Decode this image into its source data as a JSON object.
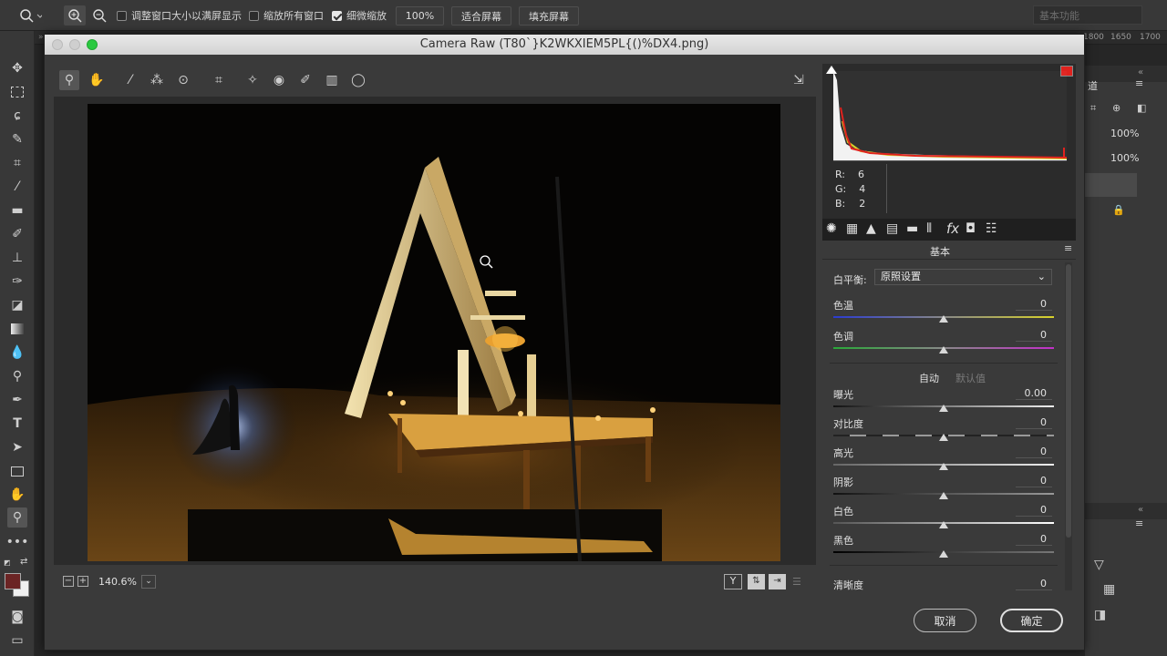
{
  "optbar": {
    "fit_window_label": "调整窗口大小以满屏显示",
    "zoom_all_label": "缩放所有窗口",
    "scrubby_label": "细微缩放",
    "zoom_value": "100%",
    "fit_screen": "适合屏幕",
    "fill_screen": "填充屏幕",
    "workspace": "基本功能"
  },
  "ruler": {
    "ticks": [
      "1800",
      "1650",
      "1700"
    ]
  },
  "rpanel": {
    "tab": "道",
    "pct1": "100%",
    "pct2": "100%"
  },
  "dialog": {
    "title": "Camera Raw (T80`}K2WKXIEM5PL{()%DX4.png)",
    "zoom": "140.6%",
    "cancel": "取消",
    "ok": "确定"
  },
  "rgb": {
    "r_label": "R:",
    "r": "6",
    "g_label": "G:",
    "g": "4",
    "b_label": "B:",
    "b": "2"
  },
  "panel": {
    "title": "基本",
    "wb_label": "白平衡:",
    "wb_value": "原照设置",
    "auto": "自动",
    "default": "默认值",
    "sliders": [
      {
        "label": "色温",
        "value": "0"
      },
      {
        "label": "色调",
        "value": "0"
      },
      {
        "label": "曝光",
        "value": "0.00"
      },
      {
        "label": "对比度",
        "value": "0"
      },
      {
        "label": "高光",
        "value": "0"
      },
      {
        "label": "阴影",
        "value": "0"
      },
      {
        "label": "白色",
        "value": "0"
      },
      {
        "label": "黑色",
        "value": "0"
      },
      {
        "label": "清晰度",
        "value": "0"
      }
    ]
  },
  "colors": {
    "accent": "#e8e8e8",
    "fg_swatch": "#6b2424",
    "histogram_red": "#e0221e",
    "histogram_yellow": "#d8d22a"
  }
}
